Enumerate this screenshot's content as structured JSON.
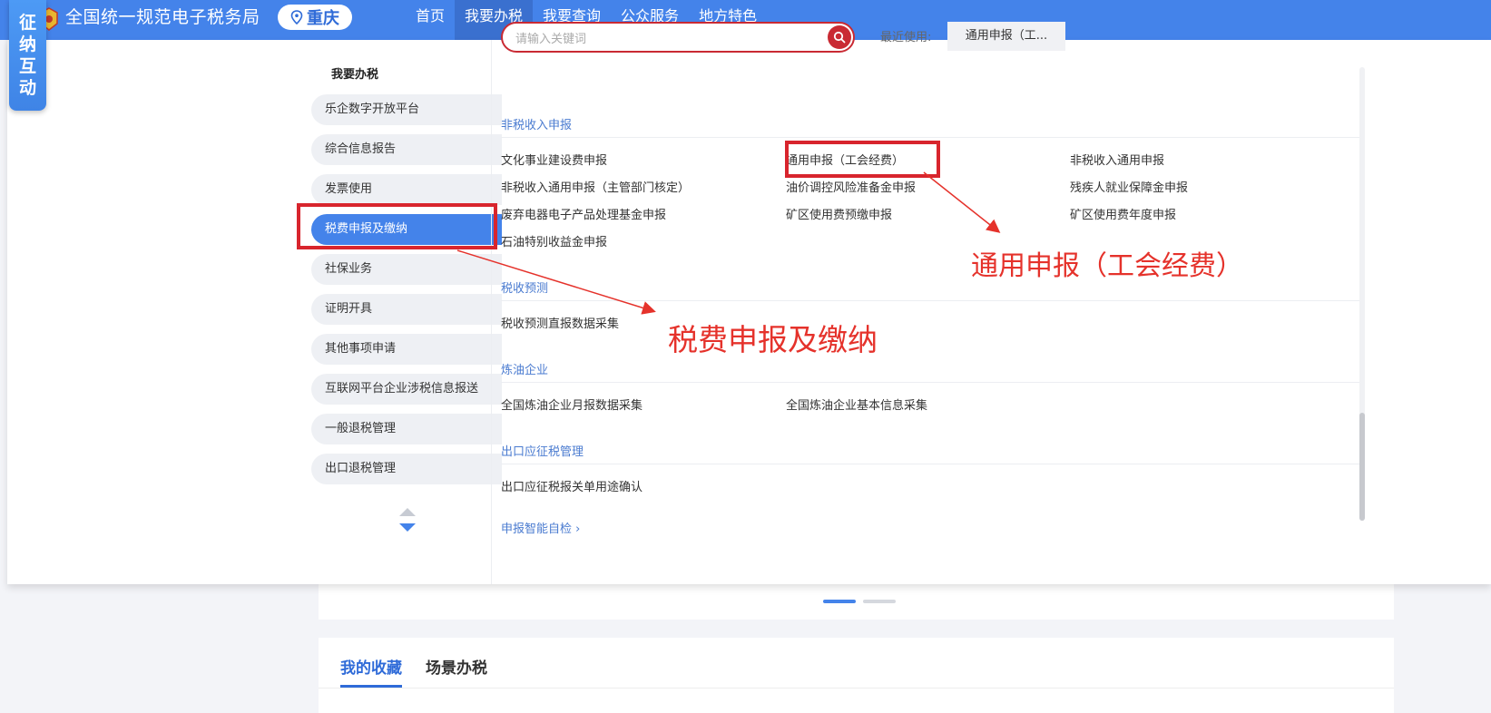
{
  "header": {
    "site_title": "全国统一规范电子税务局",
    "region": "重庆",
    "nav": [
      "首页",
      "我要办税",
      "我要查询",
      "公众服务",
      "地方特色"
    ],
    "active_nav": "我要办税"
  },
  "side_badge": {
    "chars": [
      "征",
      "纳",
      "互",
      "动"
    ]
  },
  "menu": {
    "title": "我要办税",
    "items": [
      "乐企数字开放平台",
      "综合信息报告",
      "发票使用",
      "税费申报及缴纳",
      "社保业务",
      "证明开具",
      "其他事项申请",
      "互联网平台企业涉税信息报送",
      "一般退税管理",
      "出口退税管理"
    ],
    "active_item": "税费申报及缴纳"
  },
  "search": {
    "placeholder": "请输入关键词",
    "value": ""
  },
  "recent": {
    "label": "最近使用:",
    "chip": "通用申报（工..."
  },
  "sections": [
    {
      "title": "非税收入申报",
      "rows": [
        [
          "文化事业建设费申报",
          "通用申报（工会经费）",
          "非税收入通用申报"
        ],
        [
          "非税收入通用申报（主管部门核定）",
          "油价调控风险准备金申报",
          "残疾人就业保障金申报"
        ],
        [
          "废弃电器电子产品处理基金申报",
          "矿区使用费预缴申报",
          "矿区使用费年度申报"
        ],
        [
          "石油特别收益金申报"
        ]
      ]
    },
    {
      "title": "税收预测",
      "rows": [
        [
          "税收预测直报数据采集"
        ]
      ]
    },
    {
      "title": "炼油企业",
      "rows": [
        [
          "全国炼油企业月报数据采集",
          "全国炼油企业基本信息采集"
        ]
      ]
    },
    {
      "title": "出口应征税管理",
      "rows": [
        [
          "出口应征税报关单用途确认"
        ]
      ]
    }
  ],
  "self_check": "申报智能自检",
  "favorites": {
    "tabs": [
      "我的收藏",
      "场景办税"
    ],
    "active_tab": "我的收藏"
  },
  "annotations": {
    "menu_callout": "税费申报及缴纳",
    "item_callout": "通用申报（工会经费）",
    "color": "#e5322b"
  },
  "colors": {
    "header_blue": "#4483ea",
    "active_nav": "#3a70cf",
    "search_red": "#c92a33",
    "section_blue": "#4a7bd0"
  }
}
